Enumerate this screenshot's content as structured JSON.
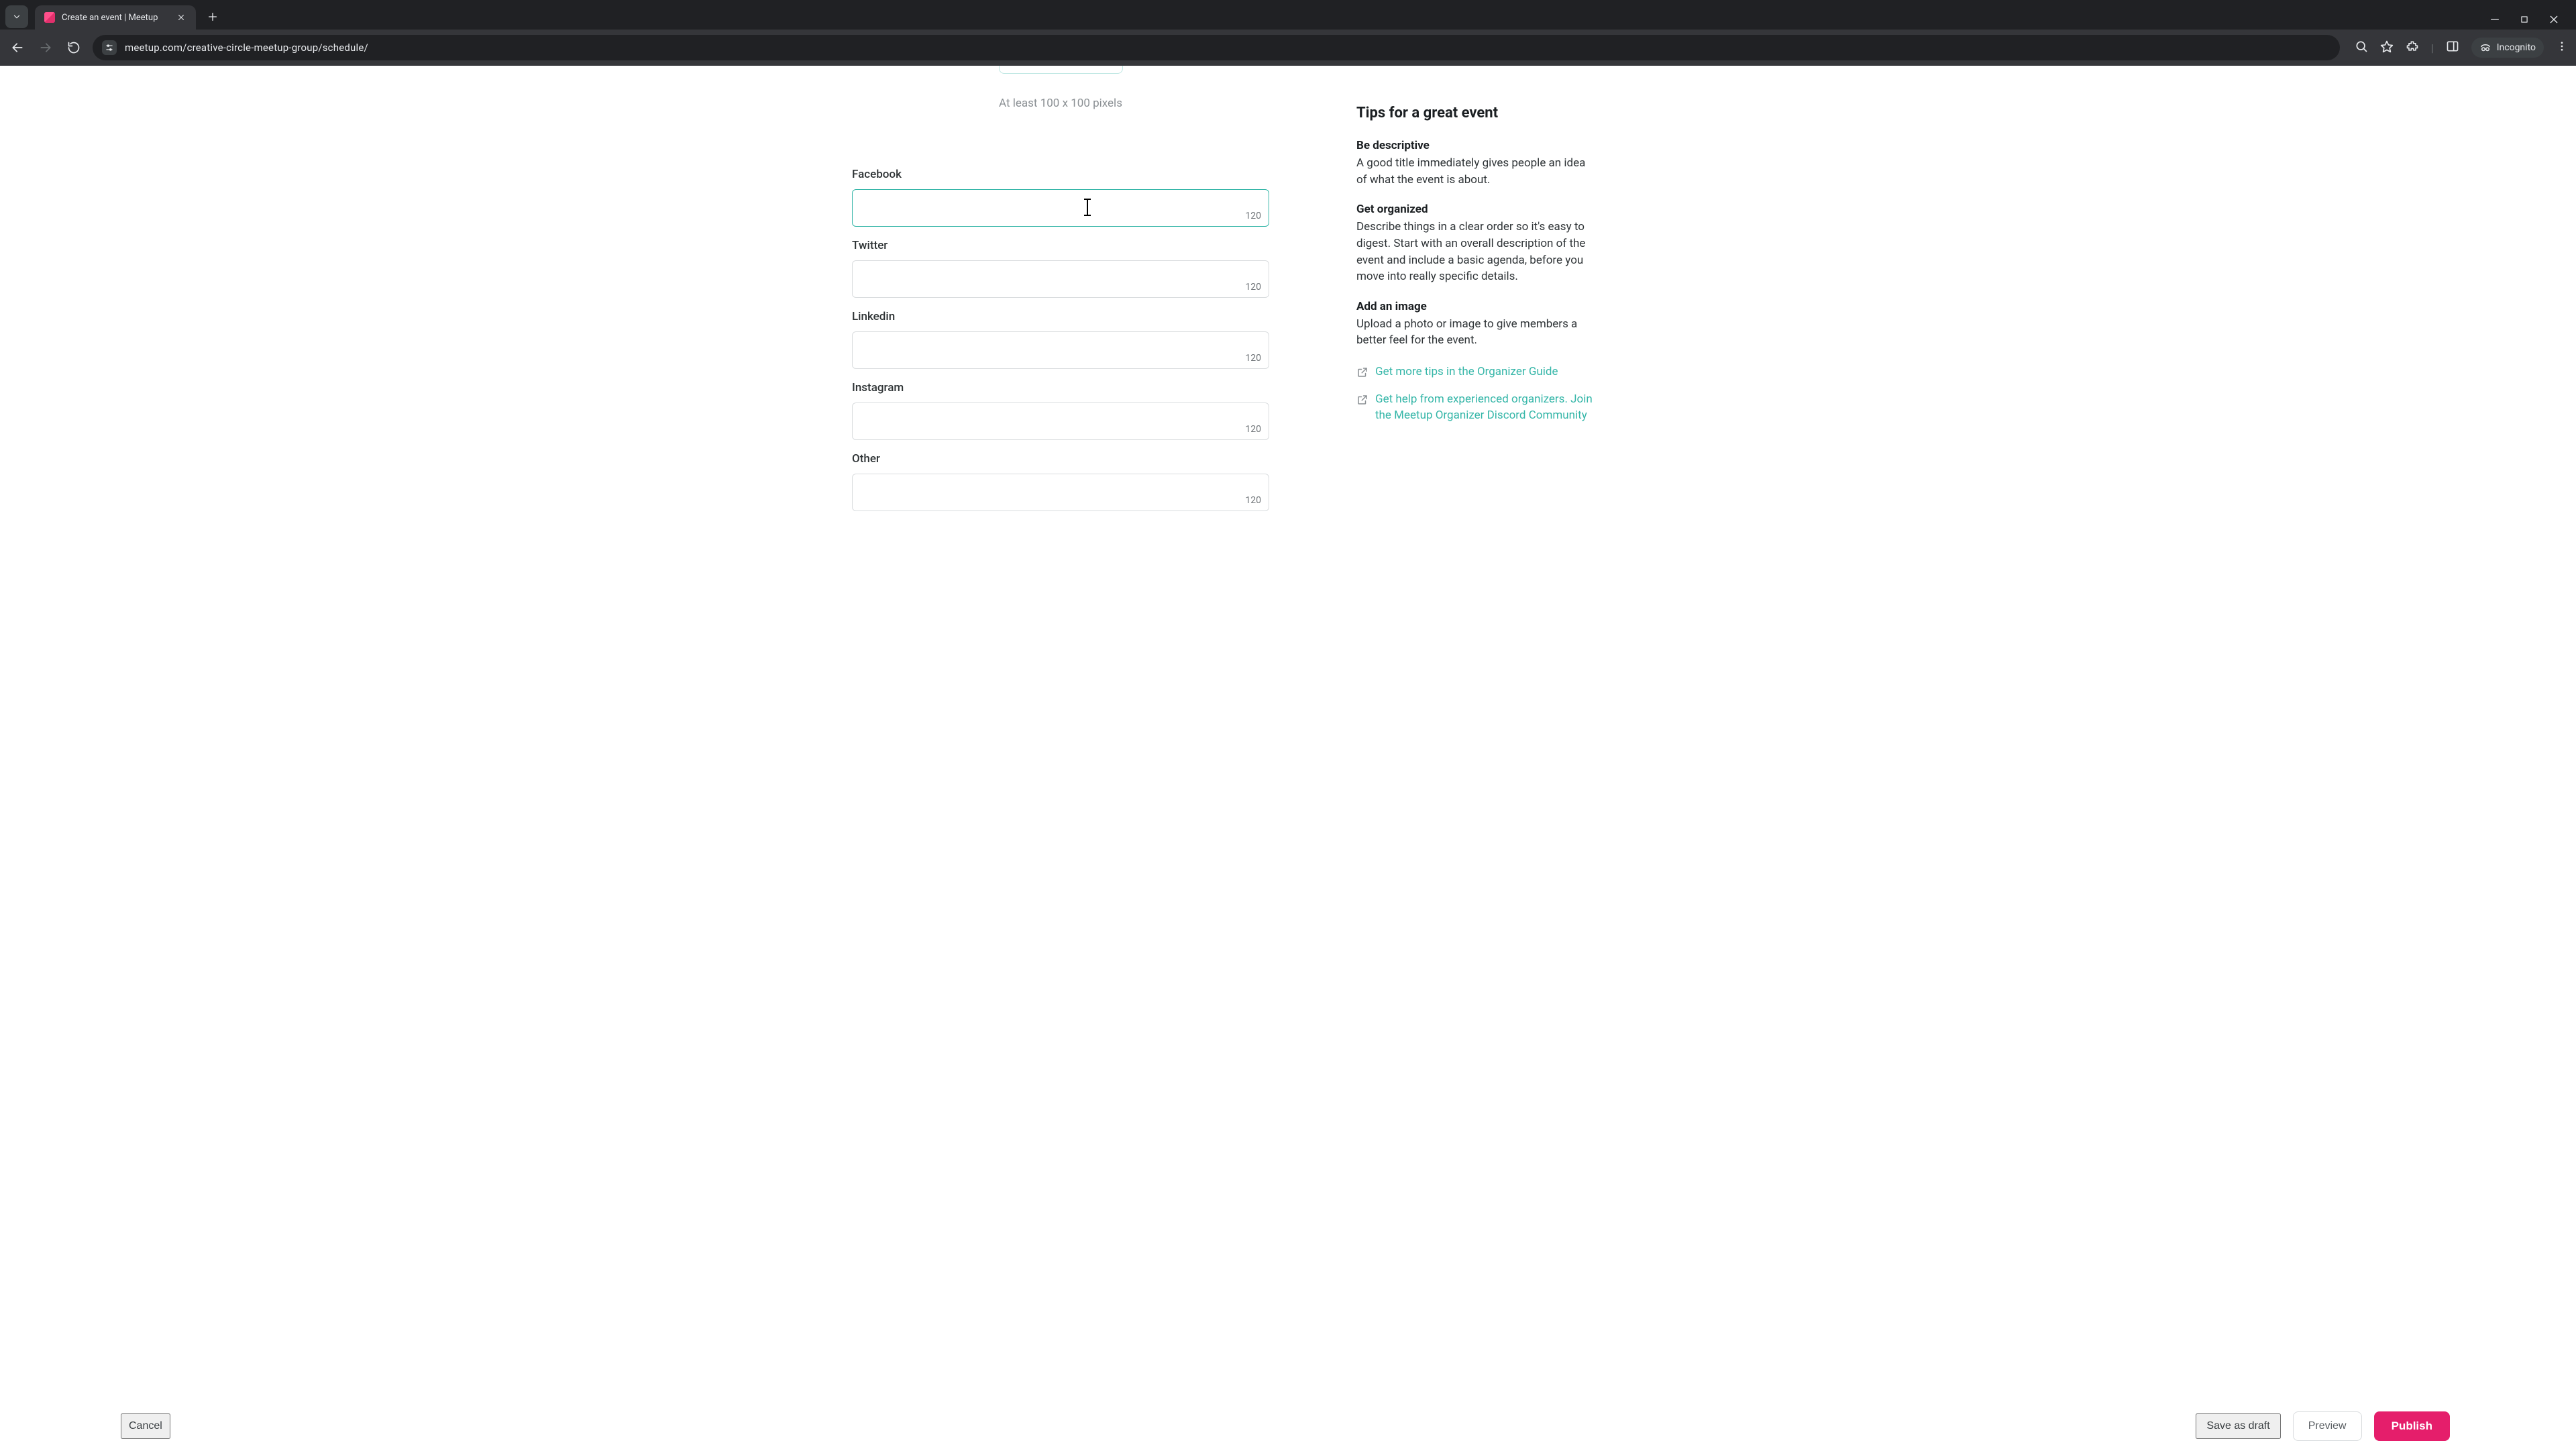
{
  "browser": {
    "tab_title": "Create an event | Meetup",
    "url": "meetup.com/creative-circle-meetup-group/schedule/",
    "incognito_label": "Incognito"
  },
  "upload_hint": "At least 100 x 100 pixels",
  "fields": {
    "facebook": {
      "label": "Facebook",
      "value": "",
      "counter": "120"
    },
    "twitter": {
      "label": "Twitter",
      "value": "",
      "counter": "120"
    },
    "linkedin": {
      "label": "Linkedin",
      "value": "",
      "counter": "120"
    },
    "instagram": {
      "label": "Instagram",
      "value": "",
      "counter": "120"
    },
    "other": {
      "label": "Other",
      "value": "",
      "counter": "120"
    }
  },
  "tips": {
    "title": "Tips for a great event",
    "descriptive": {
      "heading": "Be descriptive",
      "body": "A good title immediately gives people an idea of what the event is about."
    },
    "organized": {
      "heading": "Get organized",
      "body": "Describe things in a clear order so it's easy to digest. Start with an overall description of the event and include a basic agenda, before you move into really specific details."
    },
    "image": {
      "heading": "Add an image",
      "body": "Upload a photo or image to give members a better feel for the event."
    },
    "link1": "Get more tips in the Organizer Guide",
    "link2": "Get help from experienced organizers. Join the Meetup Organizer Discord Community"
  },
  "actions": {
    "cancel": "Cancel",
    "draft": "Save as draft",
    "preview": "Preview",
    "publish": "Publish"
  }
}
